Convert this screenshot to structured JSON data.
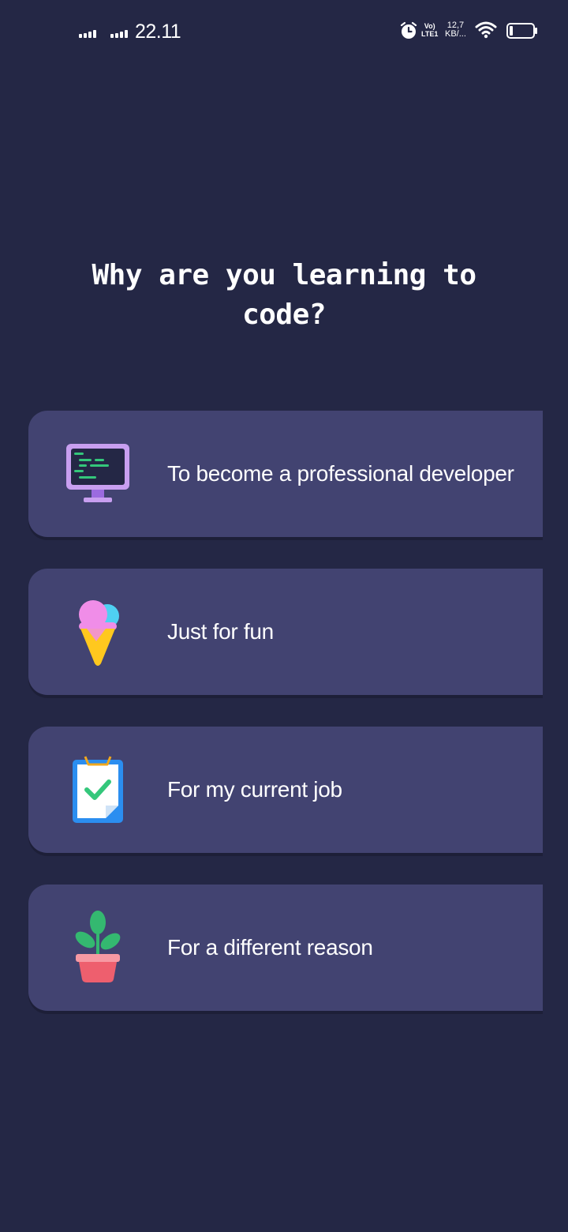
{
  "status_bar": {
    "time": "22.11",
    "volte_line1": "Vo)",
    "volte_line2": "LTE1",
    "net_speed_value": "12,7",
    "net_speed_unit": "KB/..."
  },
  "question": {
    "title": "Why are you learning to code?"
  },
  "options": [
    {
      "label": "To become a professional developer",
      "icon": "computer-monitor-icon"
    },
    {
      "label": "Just for fun",
      "icon": "ice-cream-icon"
    },
    {
      "label": "For my current job",
      "icon": "clipboard-check-icon"
    },
    {
      "label": "For a different reason",
      "icon": "potted-plant-icon"
    }
  ],
  "colors": {
    "background": "#242745",
    "card": "#424371",
    "text": "#ffffff"
  }
}
